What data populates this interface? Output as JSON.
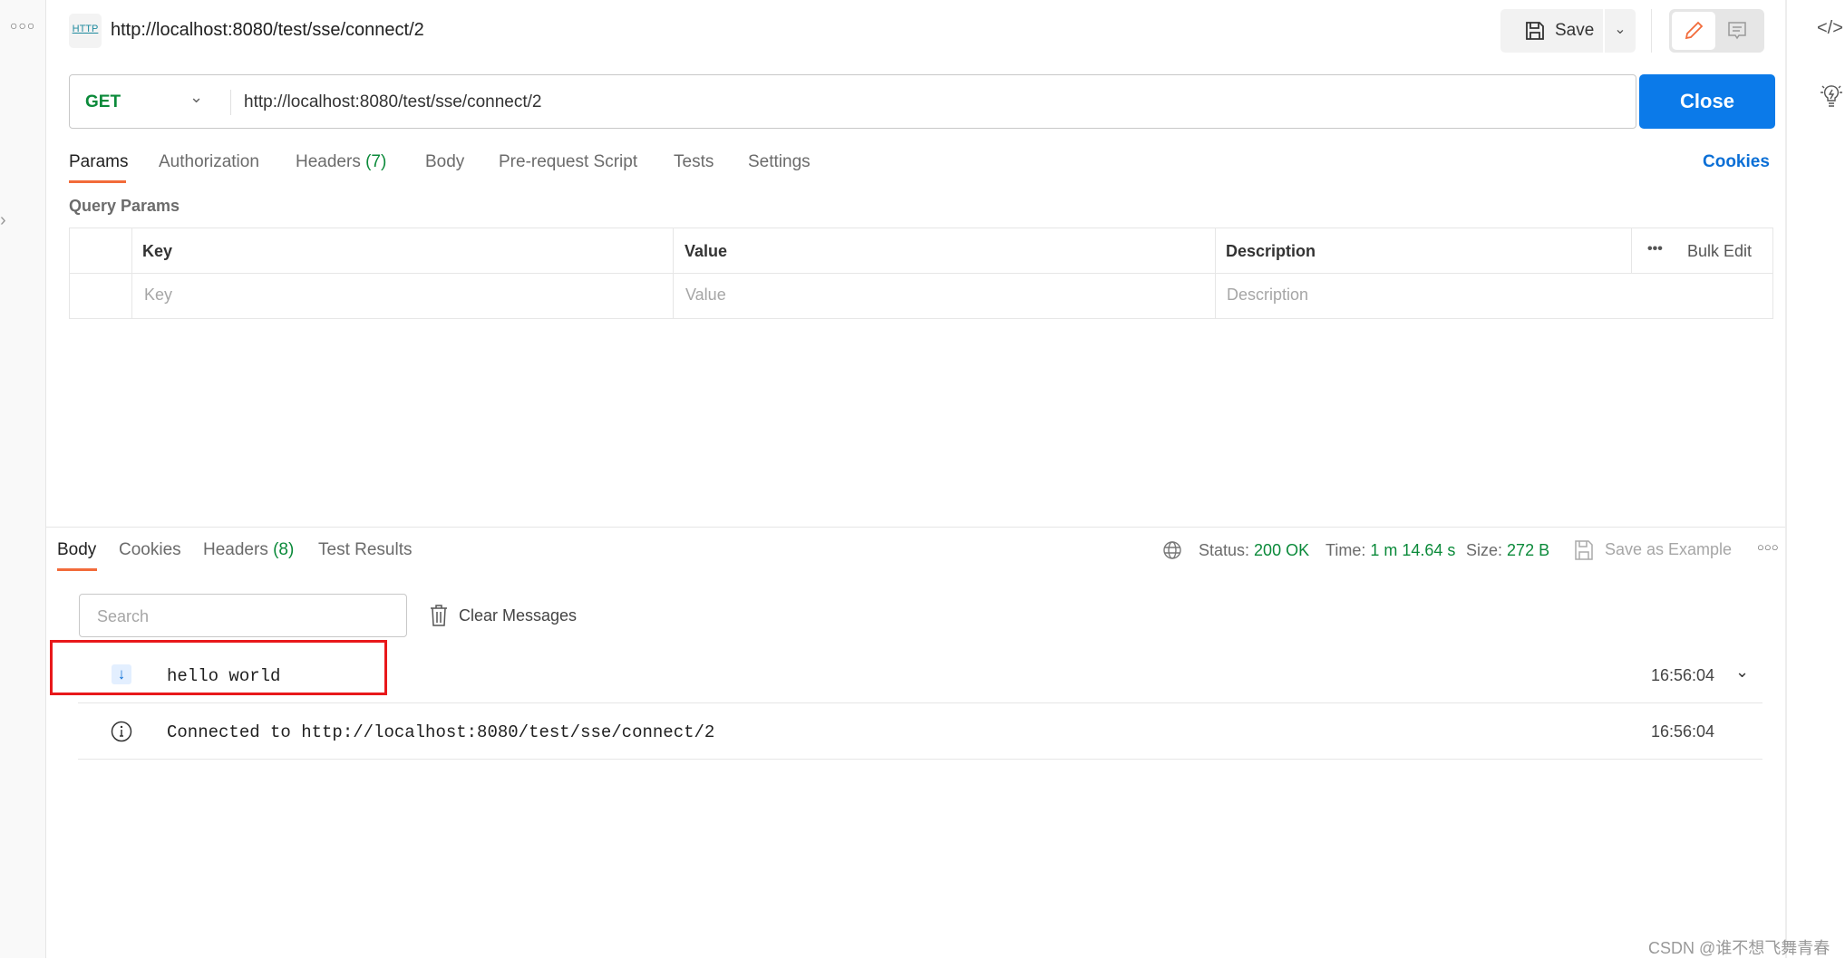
{
  "header": {
    "title": "http://localhost:8080/test/sse/connect/2",
    "save_label": "Save",
    "http_badge": "HTTP"
  },
  "request": {
    "method": "GET",
    "url": "http://localhost:8080/test/sse/connect/2",
    "send_label": "Close",
    "method_color": "#0b8a3a",
    "button_color": "#0b7ae9"
  },
  "req_tabs": [
    {
      "label": "Params"
    },
    {
      "label": "Authorization"
    },
    {
      "label": "Headers",
      "count": "(7)"
    },
    {
      "label": "Body"
    },
    {
      "label": "Pre-request Script"
    },
    {
      "label": "Tests"
    },
    {
      "label": "Settings"
    }
  ],
  "cookies_link": "Cookies",
  "query_params": {
    "title": "Query Params",
    "headers": [
      "Key",
      "Value",
      "Description"
    ],
    "bulk_edit": "Bulk Edit",
    "placeholders": [
      "Key",
      "Value",
      "Description"
    ]
  },
  "resp_tabs": [
    {
      "label": "Body"
    },
    {
      "label": "Cookies"
    },
    {
      "label": "Headers",
      "count": "(8)"
    },
    {
      "label": "Test Results"
    }
  ],
  "status": {
    "status_label": "Status:",
    "status_value": "200 OK",
    "time_label": "Time:",
    "time_value": "1 m 14.64 s",
    "size_label": "Size:",
    "size_value": "272 B",
    "save_example": "Save as Example"
  },
  "messages": {
    "search_placeholder": "Search",
    "clear_label": "Clear Messages",
    "items": [
      {
        "icon": "arrow-down-icon",
        "text": "hello world",
        "time": "16:56:04"
      },
      {
        "icon": "info-icon",
        "text": "Connected to http://localhost:8080/test/sse/connect/2",
        "time": "16:56:04"
      }
    ]
  },
  "watermark": "CSDN @谁不想飞舞青春"
}
